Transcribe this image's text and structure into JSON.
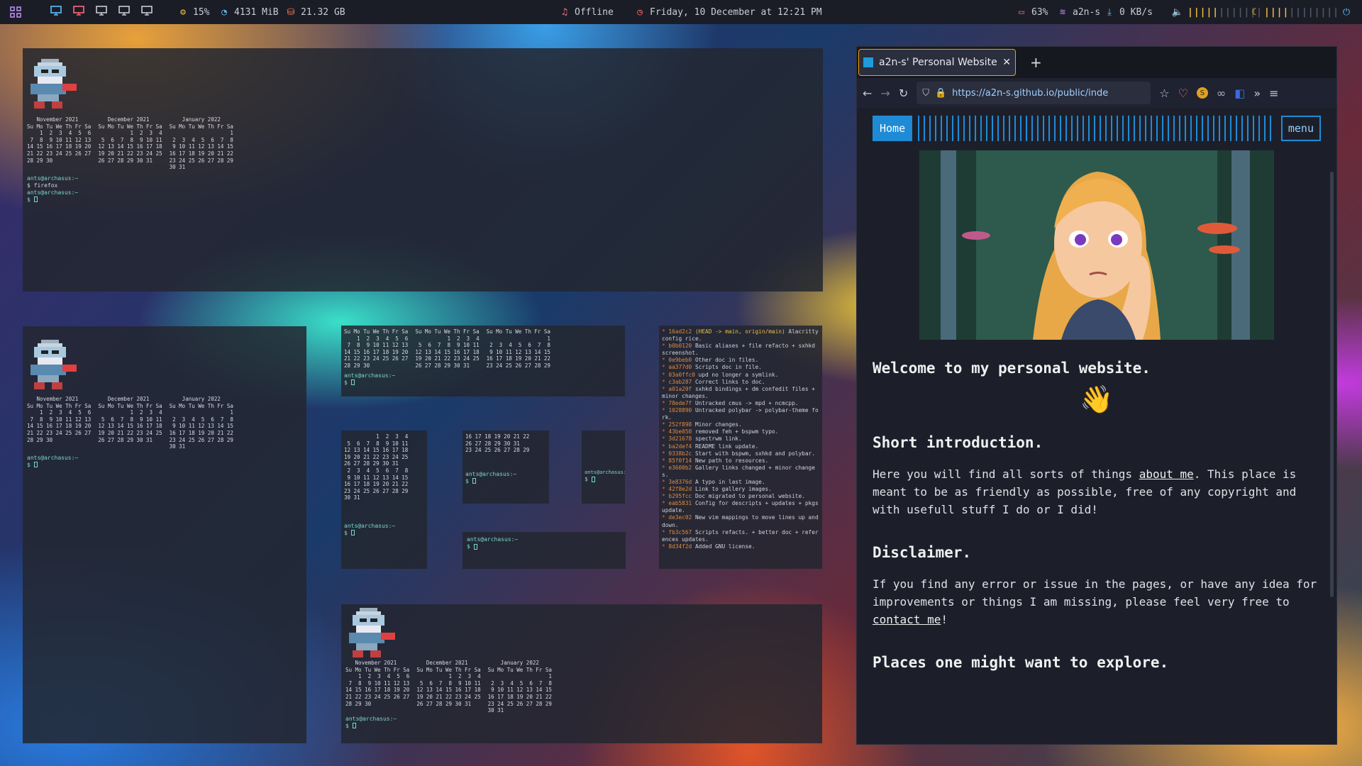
{
  "topbar": {
    "cpu": "15%",
    "ram": "4131 MiB",
    "disk": "21.32 GB",
    "music": "Offline",
    "clock": "Friday, 10 December at 12:21 PM",
    "battery": "63%",
    "wifi": "a2n-s",
    "net": "0 KB/s",
    "workspace_icons": [
      "monitor-icon",
      "monitor-icon",
      "monitor-icon",
      "monitor-icon",
      "monitor-icon"
    ]
  },
  "calendar": {
    "months": [
      {
        "title": "   November 2021",
        "header": "Su Mo Tu We Th Fr Sa",
        "rows": [
          "    1  2  3  4  5  6",
          " 7  8  9 10 11 12 13",
          "14 15 16 17 18 19 20",
          "21 22 23 24 25 26 27",
          "28 29 30"
        ]
      },
      {
        "title": "   December 2021",
        "header": "Su Mo Tu We Th Fr Sa",
        "rows": [
          "          1  2  3  4",
          " 5  6  7  8  9 10 11",
          "12 13 14 15 16 17 18",
          "19 20 21 22 23 24 25",
          "26 27 28 29 30 31"
        ]
      },
      {
        "title": "    January 2022",
        "header": "Su Mo Tu We Th Fr Sa",
        "rows": [
          "                   1",
          " 2  3  4  5  6  7  8",
          " 9 10 11 12 13 14 15",
          "16 17 18 19 20 21 22",
          "23 24 25 26 27 28 29",
          "30 31"
        ]
      }
    ]
  },
  "term1": {
    "prompt1": "ants@archasus:~",
    "cmd1": "$ firefox",
    "prompt2": "ants@archasus:~",
    "cmd2": "$ "
  },
  "term_prompt": "ants@archasus:~",
  "term_dollar": "$ ",
  "git_log": [
    {
      "h": "16ad2c2",
      "r": "(HEAD -> main, origin/main)",
      "m": "Alacritty config rice."
    },
    {
      "h": "b0b0120",
      "m": "Basic aliases + file refacto + sxhkd screenshot."
    },
    {
      "h": "0e9beb0",
      "m": "Other doc in files."
    },
    {
      "h": "aa377d0",
      "m": "Scripts doc in file."
    },
    {
      "h": "03a0ffc0",
      "m": "upd no longer a symlink."
    },
    {
      "h": "c3ab287",
      "m": "Correct links to doc."
    },
    {
      "h": "a01a20f",
      "m": "sxhkd bindings + dm confedit files + minor changes."
    },
    {
      "h": "78ede7f",
      "m": "Untracked cmus -> mpd + ncmcpp."
    },
    {
      "h": "1028890",
      "m": "Untracked polybar -> polybar-theme fork."
    },
    {
      "h": "252f898",
      "m": "Minor changes."
    },
    {
      "h": "43be050",
      "m": "removed feh + bspwm typo."
    },
    {
      "h": "3d21678",
      "m": "spectrwm link."
    },
    {
      "h": "ba2def4",
      "m": "README link update."
    },
    {
      "h": "0338b2c",
      "m": "Start with bspwm, sxhkd and polybar."
    },
    {
      "h": "85f0f14",
      "m": "New path to resources."
    },
    {
      "h": "e3600b2",
      "m": "Gallery links changed + minor changes."
    },
    {
      "h": "3e8376d",
      "m": "A typo in last image."
    },
    {
      "h": "42f8e2d",
      "m": "Link to gallery images."
    },
    {
      "h": "b295fcc",
      "m": "Doc migrated to personal website."
    },
    {
      "h": "eab5831",
      "m": "Config for descripts + updates + pkgs update."
    },
    {
      "h": "de3ec02",
      "m": "New vim mappings to move lines up and down."
    },
    {
      "h": "fb3c567",
      "m": "Scripts refacts. + better doc + references updates."
    },
    {
      "h": "8d34f2d",
      "m": "Added GNU license."
    }
  ],
  "browser": {
    "tab_title": "a2n-s' Personal Website",
    "url": "https://a2n-s.github.io/public/inde",
    "home": "Home",
    "menu": "menu",
    "welcome": "Welcome to my personal website.",
    "wave": "👋",
    "intro_title": "Short introduction.",
    "intro_1": "Here you will find all sorts of things ",
    "intro_link": "about me",
    "intro_2": ". This place is meant to be as friendly as possible, free of any copyright and with usefull stuff I do or I did!",
    "disclaimer_title": "Disclaimer.",
    "disc_1": "If you find any error or issue in the pages, or have any idea for improvements or things I am missing, please feel very free to ",
    "disc_link": "contact me",
    "disc_2": "!",
    "places_title": "Places one might want to explore."
  }
}
